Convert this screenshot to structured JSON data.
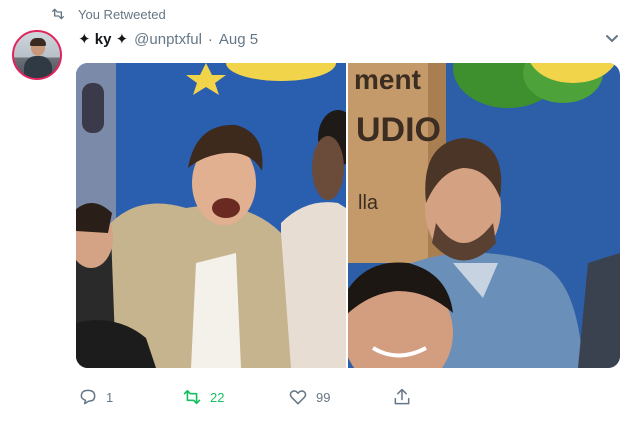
{
  "retweet_context": {
    "label": "You Retweeted",
    "icon": "retweet-icon"
  },
  "tweet": {
    "display_name": "✦ ky ✦",
    "handle": "@unptxful",
    "separator": "·",
    "time": "Aug 5",
    "menu_icon": "chevron-down-icon",
    "media": {
      "left_image": "group laughing in jackets",
      "right_image": "bearded man in denim shirt grinning",
      "right_sign_text": [
        "ment",
        "UDIO",
        "lla"
      ]
    },
    "actions": {
      "reply_count": "1",
      "retweet_count": "22",
      "like_count": "99"
    }
  },
  "colors": {
    "retweet_active": "#17bf63",
    "muted": "#657786",
    "avatar_border": "#e0245e"
  }
}
